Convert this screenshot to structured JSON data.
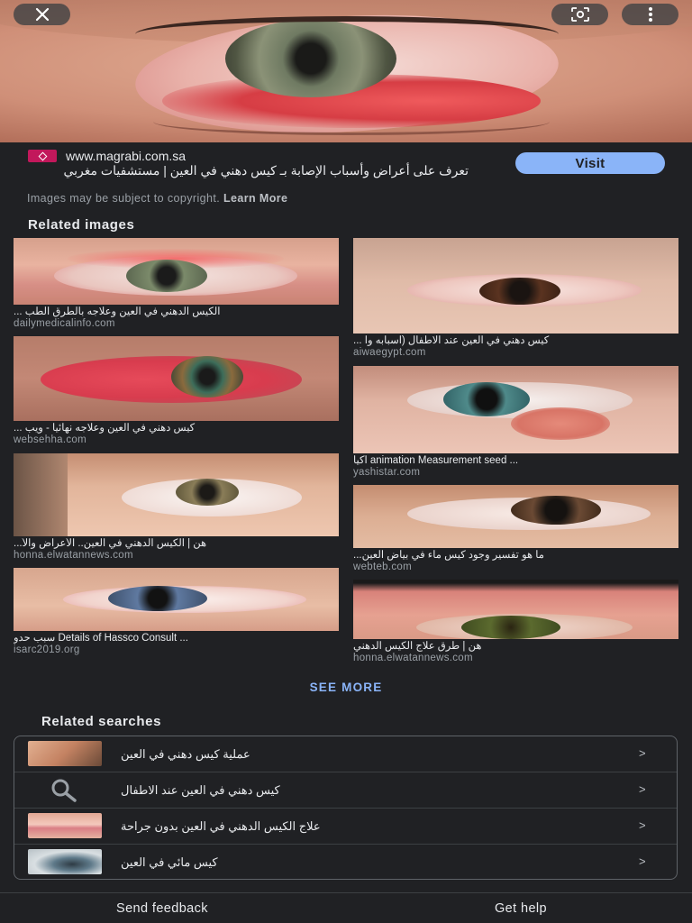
{
  "hero": {
    "close_icon": "close-icon",
    "lens_icon": "google-lens-icon",
    "more_icon": "more-vert-icon"
  },
  "source": {
    "domain": "www.magrabi.com.sa",
    "title": "تعرف على أعراض وأسباب الإصابة بـ كيس دهني في العين | مستشفيات مغربي",
    "visit_label": "Visit",
    "copyright_text": "Images may be subject to copyright.",
    "learn_more": "Learn More"
  },
  "related_images": {
    "title": "Related images",
    "items": [
      {
        "caption": "الكيس الدهني في العين وعلاجه بالطرق الطب ...",
        "source": "dailymedicalinfo.com"
      },
      {
        "caption": "كيس دهني في العين عند الاطفال (أسبابه وأ ...",
        "source": "aiwaegypt.com"
      },
      {
        "caption": "كيس دهني في العين وعلاجه نهائيا - ويب ...",
        "source": "websehha.com"
      },
      {
        "caption": "... animation Measurement seed اكيا",
        "source": "yashistar.com"
      },
      {
        "caption": "هن | الكيس الدهني في العين.. الأعراض والأ...",
        "source": "honna.elwatannews.com"
      },
      {
        "caption": "ما هو تفسير وجود كيس ماء في بياض العين...",
        "source": "webteb.com"
      },
      {
        "caption": "... Details of Hassco Consult سبب حدو",
        "source": "isarc2019.org"
      },
      {
        "caption": "هن | طرق علاج الكيس الدهني",
        "source": "honna.elwatannews.com"
      }
    ],
    "see_more": "SEE MORE"
  },
  "related_searches": {
    "title": "Related searches",
    "items": [
      {
        "label": "عملية كيس دهني في العين",
        "chevron": ">"
      },
      {
        "label": "كيس دهني في العين عند الاطفال",
        "chevron": ">"
      },
      {
        "label": "علاج الكيس الدهني في العين بدون جراحة",
        "chevron": ">"
      },
      {
        "label": "كيس مائي في العين",
        "chevron": ">"
      }
    ]
  },
  "footer": {
    "feedback": "Send feedback",
    "help": "Get help"
  },
  "colors": {
    "background": "#202124",
    "accent": "#8ab4f8",
    "muted": "#9aa0a6"
  }
}
